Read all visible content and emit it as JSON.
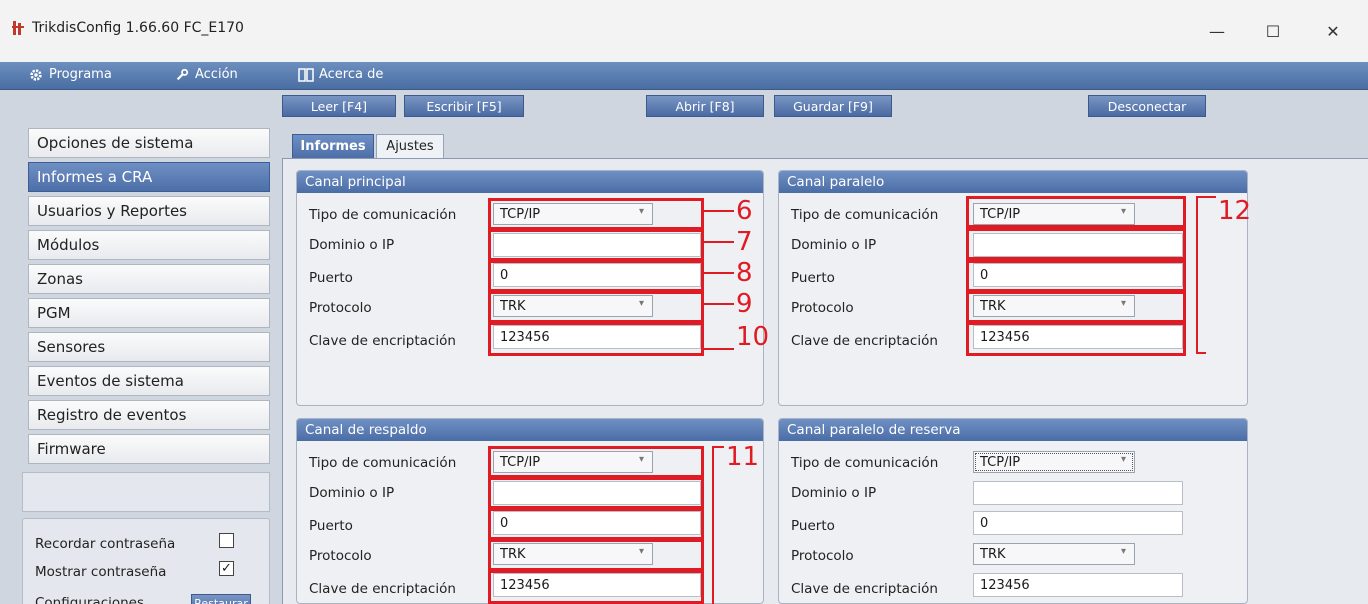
{
  "window": {
    "title": "TrikdisConfig 1.66.60   FC_E170",
    "minimize": "—",
    "maximize": "☐",
    "close": "✕"
  },
  "menu": {
    "programa": "Programa",
    "accion": "Acción",
    "acerca": "Acerca de"
  },
  "toolbar": {
    "leer": "Leer [F4]",
    "escribir": "Escribir [F5]",
    "abrir": "Abrir [F8]",
    "guardar": "Guardar [F9]",
    "desconectar": "Desconectar"
  },
  "sidebar": {
    "items": [
      "Opciones de sistema",
      "Informes a CRA",
      "Usuarios y Reportes",
      "Módulos",
      "Zonas",
      "PGM",
      "Sensores",
      "Eventos de sistema",
      "Registro de eventos",
      "Firmware"
    ],
    "active_index": 1,
    "options": {
      "recordar": "Recordar contraseña",
      "recordar_checked": false,
      "mostrar": "Mostrar contraseña",
      "mostrar_checked": true,
      "configuraciones": "Configuraciones",
      "restaurar": "Restaurar"
    }
  },
  "tabs": {
    "informes": "Informes",
    "ajustes": "Ajustes"
  },
  "labels": {
    "tipo": "Tipo de comunicación",
    "dominio": "Dominio o IP",
    "puerto": "Puerto",
    "protocolo": "Protocolo",
    "clave": "Clave de encriptación"
  },
  "panels": {
    "principal": {
      "title": "Canal principal",
      "tipo": "TCP/IP",
      "dominio": "",
      "puerto": "0",
      "protocolo": "TRK",
      "clave": "123456"
    },
    "paralelo": {
      "title": "Canal paralelo",
      "tipo": "TCP/IP",
      "dominio": "",
      "puerto": "0",
      "protocolo": "TRK",
      "clave": "123456"
    },
    "respaldo": {
      "title": "Canal de respaldo",
      "tipo": "TCP/IP",
      "dominio": "",
      "puerto": "0",
      "protocolo": "TRK",
      "clave": "123456"
    },
    "paralelo_reserva": {
      "title": "Canal paralelo de reserva",
      "tipo": "TCP/IP",
      "dominio": "",
      "puerto": "0",
      "protocolo": "TRK",
      "clave": "123456"
    }
  },
  "annotations": {
    "n6": "6",
    "n7": "7",
    "n8": "8",
    "n9": "9",
    "n10": "10",
    "n11": "11",
    "n12": "12",
    "color": "#e01b24"
  },
  "colors": {
    "accent": "#4d6fa8",
    "background": "#cfd6df"
  }
}
